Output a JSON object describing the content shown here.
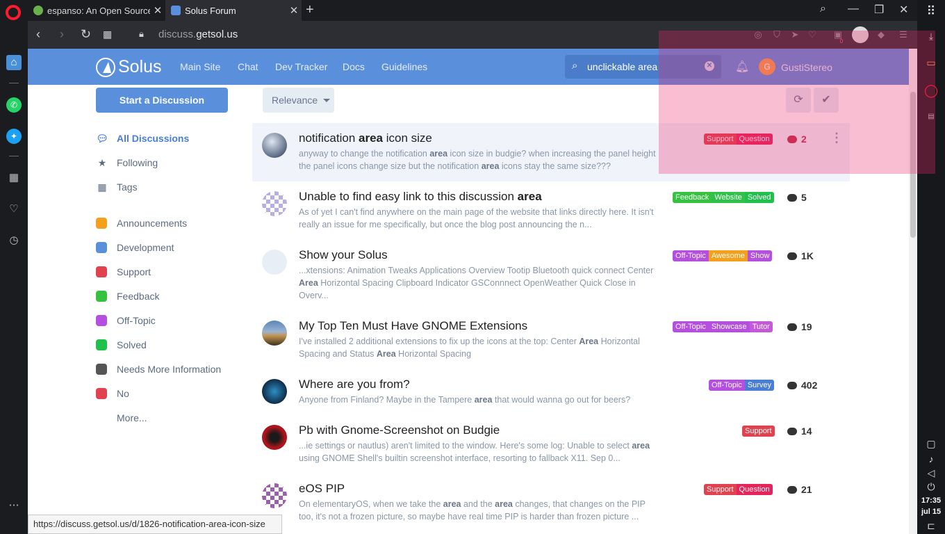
{
  "browser": {
    "tabs": [
      {
        "title": "espanso: An Open Source"
      },
      {
        "title": "Solus Forum"
      }
    ],
    "url_host": "discuss.",
    "url_domain": "getsol.us",
    "badge_count": "0"
  },
  "header": {
    "logo_text": "Solus",
    "nav": [
      "Main Site",
      "Chat",
      "Dev Tracker",
      "Docs",
      "Guidelines"
    ],
    "search_value": "unclickable area",
    "avatar_letter": "G",
    "username": "GustiStereo"
  },
  "sidebar": {
    "start_button": "Start a Discussion",
    "main_items": [
      "All Discussions",
      "Following",
      "Tags"
    ],
    "tags": [
      {
        "label": "Announcements",
        "color": "#f4a01c"
      },
      {
        "label": "Development",
        "color": "#5a8fdb"
      },
      {
        "label": "Support",
        "color": "#e0434f"
      },
      {
        "label": "Feedback",
        "color": "#35c241"
      },
      {
        "label": "Off-Topic",
        "color": "#b54fe0"
      },
      {
        "label": "Solved",
        "color": "#1fc14b"
      },
      {
        "label": "Needs More Information",
        "color": "#555555"
      },
      {
        "label": "No",
        "color": "#e0434f"
      }
    ],
    "more": "More..."
  },
  "toolbar": {
    "relevance": "Relevance"
  },
  "colors": {
    "accent": "#5a8fdb",
    "support": "#e0434f",
    "question": "#e8235a",
    "feedback": "#35c241",
    "website": "#2fc14a",
    "solved": "#1fc14b",
    "offtopic": "#b54fe0",
    "awesome": "#f4a01c",
    "showcase": "#b54fe0",
    "survey": "#4a7ed6"
  },
  "discussions": [
    {
      "title_pre": "notification ",
      "title_bold": "area",
      "title_post": " icon size",
      "excerpt": [
        {
          "t": "anyway to change the notification "
        },
        {
          "b": "area"
        },
        {
          "t": " icon size in budgie? when increasing the panel height the panel icons change size but the notification "
        },
        {
          "b": "area"
        },
        {
          "t": " icons stay the same size???"
        }
      ],
      "tags": [
        "Support",
        "Question"
      ],
      "count": "2"
    },
    {
      "title_pre": "Unable to find easy link to this discussion ",
      "title_bold": "area",
      "title_post": "",
      "excerpt": [
        {
          "t": "As of yet I can't find anywhere on the main page of the website that links directly here. It isn't really an issue for me specifically, but once the blog post announcing the n..."
        }
      ],
      "tags": [
        "Feedback",
        "Website",
        "Solved"
      ],
      "count": "5"
    },
    {
      "title_pre": "Show your Solus",
      "title_bold": "",
      "title_post": "",
      "excerpt": [
        {
          "t": "...xtensions: Animation Tweaks Applications Overview Tootip Bluetooth quick connect Center "
        },
        {
          "b": "Area"
        },
        {
          "t": " Horizontal Spacing Clipboard Indicator GSConnnect OpenWeather Quick Close in Overv..."
        }
      ],
      "tags": [
        "Off-Topic",
        "Awesome",
        "Show"
      ],
      "count": "1K"
    },
    {
      "title_pre": "My Top Ten Must Have GNOME Extensions",
      "title_bold": "",
      "title_post": "",
      "excerpt": [
        {
          "t": "I've installed 2 additional extensions to fix up the icons at the top: Center "
        },
        {
          "b": "Area"
        },
        {
          "t": " Horizontal Spacing and Status "
        },
        {
          "b": "Area"
        },
        {
          "t": " Horizontal Spacing"
        }
      ],
      "tags": [
        "Off-Topic",
        "Showcase",
        "Tutor"
      ],
      "count": "19"
    },
    {
      "title_pre": "Where are you from?",
      "title_bold": "",
      "title_post": "",
      "excerpt": [
        {
          "t": "Anyone from Finland? Maybe in the Tampere "
        },
        {
          "b": "area"
        },
        {
          "t": " that would wanna go out for beers?"
        }
      ],
      "tags": [
        "Off-Topic",
        "Survey"
      ],
      "count": "402"
    },
    {
      "title_pre": "Pb with Gnome-Screenshot on Budgie",
      "title_bold": "",
      "title_post": "",
      "excerpt": [
        {
          "t": "...ie settings or nautlus) aren't limited to the window. Here's some log: Unable to select "
        },
        {
          "b": "area"
        },
        {
          "t": " using GNOME Shell's builtin screenshot interface, resorting to fallback X11. Sep 0..."
        }
      ],
      "tags": [
        "Support"
      ],
      "count": "14"
    },
    {
      "title_pre": "eOS PIP",
      "title_bold": "",
      "title_post": "",
      "excerpt": [
        {
          "t": "On elementaryOS, when we take the "
        },
        {
          "b": "area"
        },
        {
          "t": " and the "
        },
        {
          "b": "area"
        },
        {
          "t": " changes, that changes on the PIP too, it's not a frozen picture, so maybe have real time PIP is harder than frozen picture ..."
        }
      ],
      "tags": [
        "Support",
        "Question"
      ],
      "count": "21"
    }
  ],
  "statusbar": "https://discuss.getsol.us/d/1826-notification-area-icon-size",
  "system": {
    "time": "17:35",
    "date": "jul 15"
  }
}
